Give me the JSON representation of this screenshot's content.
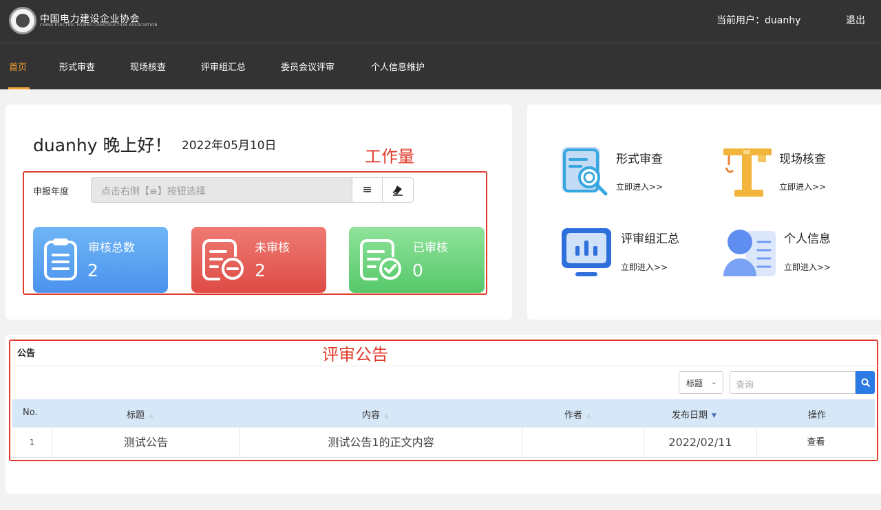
{
  "header": {
    "org_name": "中国电力建设企业协会",
    "org_name_en": "CHINA ELECTRIC POWER CONSTRUCTION ASSOCIATION",
    "current_user_label": "当前用户：duanhy",
    "logout_label": "退出"
  },
  "nav": {
    "items": [
      {
        "label": "首页",
        "active": true
      },
      {
        "label": "形式审查"
      },
      {
        "label": "现场核查"
      },
      {
        "label": "评审组汇总"
      },
      {
        "label": "委员会议评审"
      },
      {
        "label": "个人信息维护"
      }
    ]
  },
  "dashboard": {
    "greeting": "duanhy 晚上好！",
    "date": "2022年05月10日",
    "annotation": "工作量",
    "year_label": "申报年度",
    "year_placeholder": "点击右侧【≡】按钮选择",
    "list_button_icon": "≡",
    "stats": [
      {
        "title": "审核总数",
        "value": "2",
        "color": "#4b93ee",
        "icon": "clipboard-icon"
      },
      {
        "title": "未审核",
        "value": "2",
        "color": "#de4b45",
        "icon": "document-minus-icon"
      },
      {
        "title": "已审核",
        "value": "0",
        "color": "#56c86a",
        "icon": "document-check-icon"
      }
    ]
  },
  "quick_links": [
    {
      "title": "形式审查",
      "link": "立即进入>>",
      "icon": "document-search-icon"
    },
    {
      "title": "现场核查",
      "link": "立即进入>>",
      "icon": "crane-icon"
    },
    {
      "title": "评审组汇总",
      "link": "立即进入>>",
      "icon": "monitor-chart-icon"
    },
    {
      "title": "个人信息",
      "link": "立即进入>>",
      "icon": "user-card-icon"
    }
  ],
  "notice": {
    "title": "公告",
    "annotation": "评审公告",
    "filter_select": "标题",
    "search_placeholder": "查询",
    "columns": [
      "No.",
      "标题",
      "内容",
      "作者",
      "发布日期",
      "操作"
    ],
    "rows": [
      {
        "no": "1",
        "title": "测试公告",
        "content": "测试公告1的正文内容",
        "author": "",
        "date": "2022/02/11",
        "action": "查看"
      }
    ]
  }
}
